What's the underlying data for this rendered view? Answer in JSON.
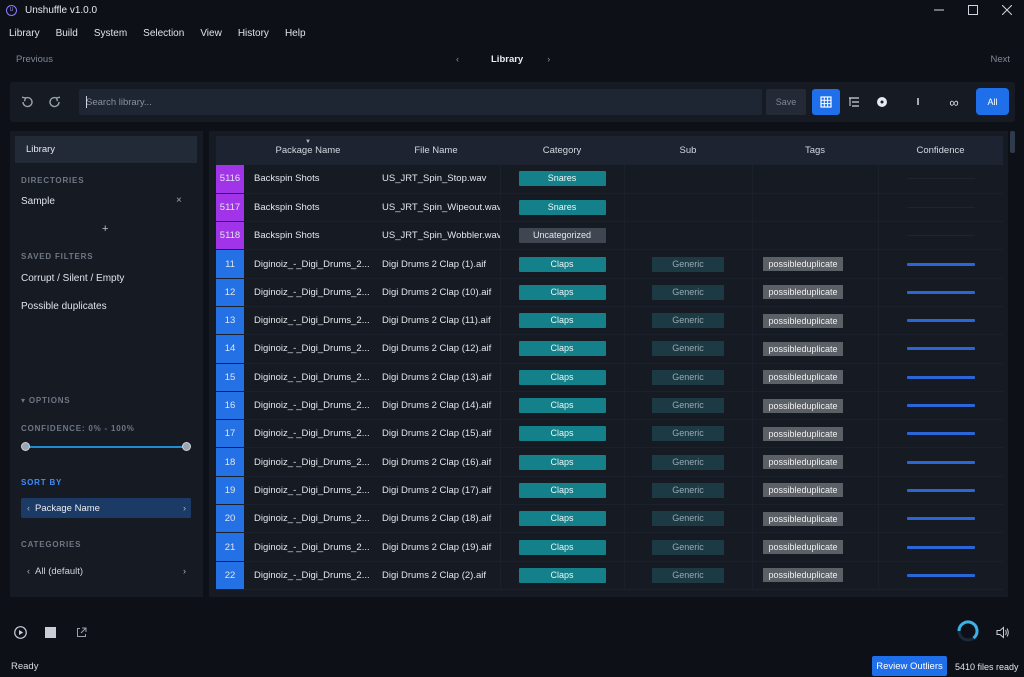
{
  "window": {
    "title": "Unshuffle v1.0.0",
    "logo_text": "U"
  },
  "menu": [
    "Library",
    "Build",
    "System",
    "Selection",
    "View",
    "History",
    "Help"
  ],
  "nav": {
    "previous": "Previous",
    "title": "Library",
    "next": "Next"
  },
  "toolbar": {
    "search_placeholder": "Search library...",
    "save_label": "Save",
    "all_label": "All",
    "info_glyph": "I",
    "infinity_glyph": "∞"
  },
  "sidebar": {
    "library_label": "Library",
    "directories_heading": "DIRECTORIES",
    "directory": "Sample",
    "close_glyph": "×",
    "add_glyph": "+",
    "saved_filters_heading": "SAVED FILTERS",
    "saved_filters": [
      "Corrupt / Silent / Empty",
      "Possible duplicates"
    ],
    "options_heading": "▾  OPTIONS",
    "confidence_label": "CONFIDENCE: 0% - 100%",
    "confidence_range": [
      0,
      100
    ],
    "sort_heading": "SORT BY",
    "sort_value": "Package Name",
    "categories_heading": "CATEGORIES",
    "category_value": "All (default)"
  },
  "table": {
    "columns": [
      "",
      "Package Name",
      "File Name",
      "Category",
      "Sub",
      "Tags",
      "Confidence"
    ],
    "rows": [
      {
        "idx": "5116",
        "color": "purple",
        "pkg": "Backspin Shots",
        "file": "US_JRT_Spin_Stop.wav",
        "cat": "Snares",
        "sub": "",
        "tag": "",
        "conf": 0
      },
      {
        "idx": "5117",
        "color": "purple",
        "pkg": "Backspin Shots",
        "file": "US_JRT_Spin_Wipeout.wav",
        "cat": "Snares",
        "sub": "",
        "tag": "",
        "conf": 0
      },
      {
        "idx": "5118",
        "color": "purple",
        "pkg": "Backspin Shots",
        "file": "US_JRT_Spin_Wobbler.wav",
        "cat": "Uncategorized",
        "sub": "",
        "tag": "",
        "conf": 0
      },
      {
        "idx": "11",
        "color": "blue",
        "pkg": "Diginoiz_-_Digi_Drums_2...",
        "file": "Digi Drums 2 Clap (1).aif",
        "cat": "Claps",
        "sub": "Generic",
        "tag": "possibleduplicate",
        "conf": 1
      },
      {
        "idx": "12",
        "color": "blue",
        "pkg": "Diginoiz_-_Digi_Drums_2...",
        "file": "Digi Drums 2 Clap (10).aif",
        "cat": "Claps",
        "sub": "Generic",
        "tag": "possibleduplicate",
        "conf": 1
      },
      {
        "idx": "13",
        "color": "blue",
        "pkg": "Diginoiz_-_Digi_Drums_2...",
        "file": "Digi Drums 2 Clap (11).aif",
        "cat": "Claps",
        "sub": "Generic",
        "tag": "possibleduplicate",
        "conf": 1
      },
      {
        "idx": "14",
        "color": "blue",
        "pkg": "Diginoiz_-_Digi_Drums_2...",
        "file": "Digi Drums 2 Clap (12).aif",
        "cat": "Claps",
        "sub": "Generic",
        "tag": "possibleduplicate",
        "conf": 1
      },
      {
        "idx": "15",
        "color": "blue",
        "pkg": "Diginoiz_-_Digi_Drums_2...",
        "file": "Digi Drums 2 Clap (13).aif",
        "cat": "Claps",
        "sub": "Generic",
        "tag": "possibleduplicate",
        "conf": 1
      },
      {
        "idx": "16",
        "color": "blue",
        "pkg": "Diginoiz_-_Digi_Drums_2...",
        "file": "Digi Drums 2 Clap (14).aif",
        "cat": "Claps",
        "sub": "Generic",
        "tag": "possibleduplicate",
        "conf": 1
      },
      {
        "idx": "17",
        "color": "blue",
        "pkg": "Diginoiz_-_Digi_Drums_2...",
        "file": "Digi Drums 2 Clap (15).aif",
        "cat": "Claps",
        "sub": "Generic",
        "tag": "possibleduplicate",
        "conf": 1
      },
      {
        "idx": "18",
        "color": "blue",
        "pkg": "Diginoiz_-_Digi_Drums_2...",
        "file": "Digi Drums 2 Clap (16).aif",
        "cat": "Claps",
        "sub": "Generic",
        "tag": "possibleduplicate",
        "conf": 1
      },
      {
        "idx": "19",
        "color": "blue",
        "pkg": "Diginoiz_-_Digi_Drums_2...",
        "file": "Digi Drums 2 Clap (17).aif",
        "cat": "Claps",
        "sub": "Generic",
        "tag": "possibleduplicate",
        "conf": 1
      },
      {
        "idx": "20",
        "color": "blue",
        "pkg": "Diginoiz_-_Digi_Drums_2...",
        "file": "Digi Drums 2 Clap (18).aif",
        "cat": "Claps",
        "sub": "Generic",
        "tag": "possibleduplicate",
        "conf": 1
      },
      {
        "idx": "21",
        "color": "blue",
        "pkg": "Diginoiz_-_Digi_Drums_2...",
        "file": "Digi Drums 2 Clap (19).aif",
        "cat": "Claps",
        "sub": "Generic",
        "tag": "possibleduplicate",
        "conf": 1
      },
      {
        "idx": "22",
        "color": "blue",
        "pkg": "Diginoiz_-_Digi_Drums_2...",
        "file": "Digi Drums 2 Clap (2).aif",
        "cat": "Claps",
        "sub": "Generic",
        "tag": "possibleduplicate",
        "conf": 1
      }
    ]
  },
  "status": {
    "ready": "Ready",
    "review_label": "Review Outliers",
    "files_count": "5410 files ready"
  },
  "colors": {
    "accent": "#1f6feb",
    "purple_marker": "#a134e8",
    "blue_marker": "#2471e6",
    "category_teal": "#14808a"
  }
}
